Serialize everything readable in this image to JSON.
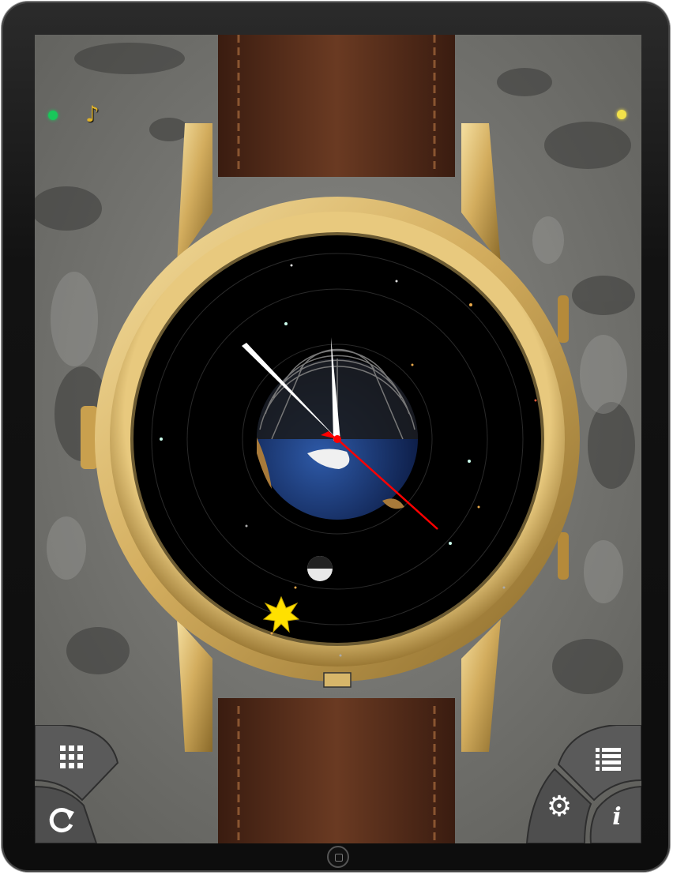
{
  "app": {
    "status": {
      "left_dot_color": "#19c75a",
      "right_dot_color": "#f2e14a",
      "music_icon": "music-note-icon",
      "music_glyph": "♪"
    },
    "watch": {
      "case_color": "#d8b86a",
      "strap_color": "#5a2f1c",
      "dial_color": "#000000",
      "hands": {
        "hour_color": "#ffffff",
        "minute_color": "#ffffff",
        "second_color": "#ff0000"
      },
      "earth_icon": "earth-globe-icon",
      "moon_icon": "moon-icon",
      "sun_icon": "sun-icon"
    },
    "controls": {
      "grid_button_icon": "grid-icon",
      "refresh_button_icon": "refresh-icon",
      "list_button_icon": "list-icon",
      "settings_button_icon": "gear-icon",
      "info_button_icon": "info-icon",
      "settings_glyph": "⚙",
      "info_glyph": "i"
    }
  }
}
